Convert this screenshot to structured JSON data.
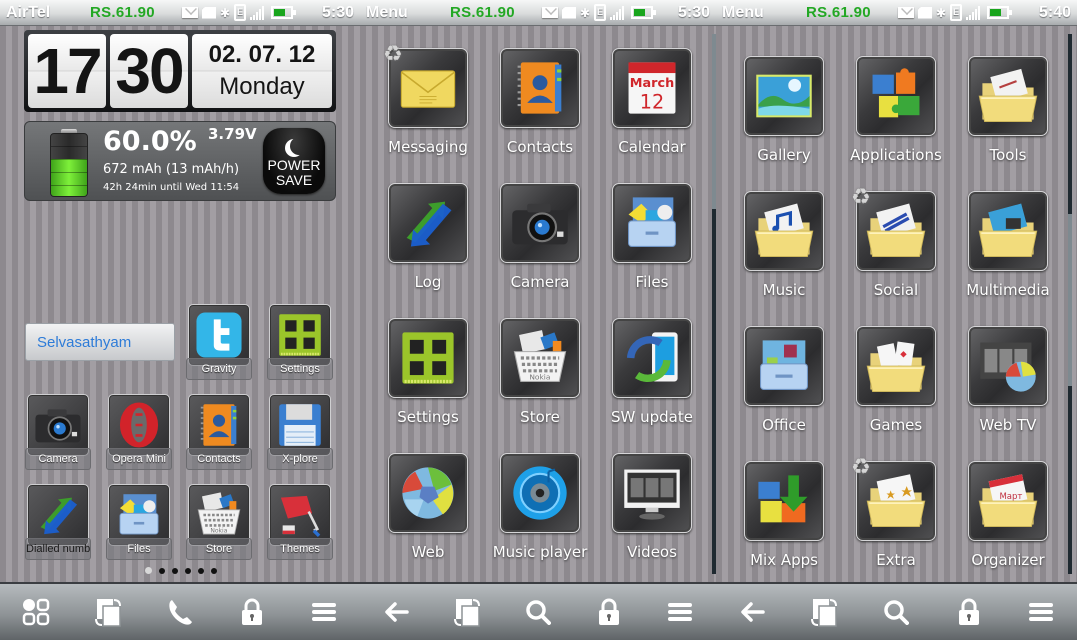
{
  "screens": [
    {
      "status": {
        "title": "AirTel",
        "credit": "RS.61.90",
        "time": "5:30"
      },
      "clock": {
        "hours": "17",
        "minutes": "30",
        "date": "02. 07. 12",
        "day": "Monday"
      },
      "battery": {
        "percent_text": "60.0%",
        "level_percent": 60,
        "voltage": "3.79V",
        "current": "672 mAh (13 mAh/h)",
        "eta": "42h 24min until Wed 11:54",
        "power_save_label_1": "POWER",
        "power_save_label_2": "SAVE"
      },
      "name_widget": "Selvasathyam",
      "shortcuts": [
        {
          "label": "Gravity",
          "icon": "twitter-icon"
        },
        {
          "label": "Settings",
          "icon": "circuit-board-icon"
        },
        {
          "label": "Camera",
          "icon": "camera-icon"
        },
        {
          "label": "Opera Mini",
          "icon": "opera-icon"
        },
        {
          "label": "Contacts",
          "icon": "contacts-book-icon"
        },
        {
          "label": "X-plore",
          "icon": "floppy-disk-icon"
        },
        {
          "label": "Dialled numb",
          "icon": "call-log-arrows-icon"
        },
        {
          "label": "Files",
          "icon": "file-drawer-icon"
        },
        {
          "label": "Store",
          "icon": "store-basket-icon"
        },
        {
          "label": "Themes",
          "icon": "paint-roller-icon"
        }
      ],
      "pages": {
        "count": 6,
        "active": 1
      },
      "navbar": [
        {
          "name": "apps-grid-icon"
        },
        {
          "name": "task-switcher-icon"
        },
        {
          "name": "phone-icon"
        },
        {
          "name": "lock-icon"
        },
        {
          "name": "menu-icon"
        }
      ]
    },
    {
      "status": {
        "title": "Menu",
        "credit": "RS.61.90",
        "time": "5:30"
      },
      "items": [
        {
          "label": "Messaging",
          "icon": "envelope-icon",
          "syncing": true
        },
        {
          "label": "Contacts",
          "icon": "contacts-book-icon"
        },
        {
          "label": "Calendar",
          "icon": "calendar-icon",
          "month": "March",
          "day": "12"
        },
        {
          "label": "Log",
          "icon": "call-log-arrows-icon"
        },
        {
          "label": "Camera",
          "icon": "camera-icon"
        },
        {
          "label": "Files",
          "icon": "file-drawer-icon"
        },
        {
          "label": "Settings",
          "icon": "circuit-board-icon"
        },
        {
          "label": "Store",
          "icon": "store-basket-icon"
        },
        {
          "label": "SW update",
          "icon": "sw-update-icon"
        },
        {
          "label": "Web",
          "icon": "web-browser-icon"
        },
        {
          "label": "Music player",
          "icon": "music-player-icon"
        },
        {
          "label": "Videos",
          "icon": "video-monitor-icon"
        }
      ],
      "navbar": [
        {
          "name": "back-arrow-icon"
        },
        {
          "name": "task-switcher-icon"
        },
        {
          "name": "search-icon"
        },
        {
          "name": "lock-icon"
        },
        {
          "name": "menu-icon"
        }
      ]
    },
    {
      "status": {
        "title": "Menu",
        "credit": "RS.61.90",
        "time": "5:40"
      },
      "items": [
        {
          "label": "Gallery",
          "icon": "gallery-picture-icon"
        },
        {
          "label": "Applications",
          "icon": "puzzle-icon"
        },
        {
          "label": "Tools",
          "icon": "folder-tools-icon"
        },
        {
          "label": "Music",
          "icon": "folder-music-icon"
        },
        {
          "label": "Social",
          "icon": "folder-social-icon",
          "syncing": true
        },
        {
          "label": "Multimedia",
          "icon": "folder-multimedia-icon"
        },
        {
          "label": "Office",
          "icon": "office-icon"
        },
        {
          "label": "Games",
          "icon": "folder-games-icon"
        },
        {
          "label": "Web TV",
          "icon": "web-tv-icon"
        },
        {
          "label": "Mix Apps",
          "icon": "mix-apps-icon"
        },
        {
          "label": "Extra",
          "icon": "folder-extra-icon",
          "syncing": true
        },
        {
          "label": "Organizer",
          "icon": "folder-organizer-icon"
        }
      ],
      "navbar": [
        {
          "name": "back-arrow-icon"
        },
        {
          "name": "task-switcher-icon"
        },
        {
          "name": "search-icon"
        },
        {
          "name": "lock-icon"
        },
        {
          "name": "menu-icon"
        }
      ]
    }
  ],
  "colors": {
    "credit_green": "#23a824",
    "name_blue": "#2d7bd8",
    "battery_green": "#19a51d"
  }
}
